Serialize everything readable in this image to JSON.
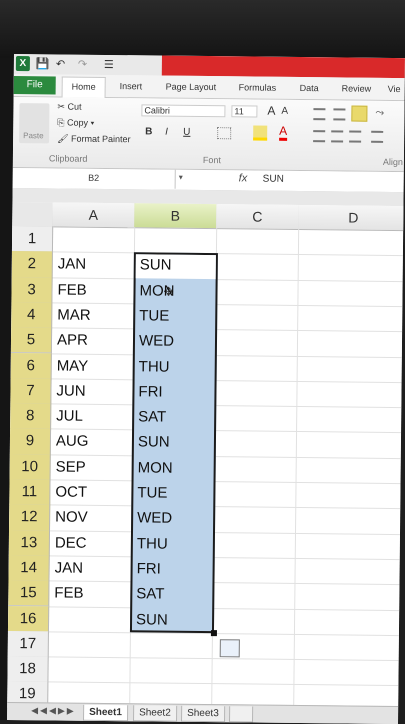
{
  "qat": {
    "app_icon": "X",
    "save": "💾",
    "undo": "↶",
    "redo": "↷",
    "customize": "☰"
  },
  "tabs": {
    "file": "File",
    "home": "Home",
    "insert": "Insert",
    "page_layout": "Page Layout",
    "formulas": "Formulas",
    "data": "Data",
    "review": "Review",
    "view": "Vie"
  },
  "ribbon": {
    "cut": "Cut",
    "copy": "Copy",
    "format_painter": "Format Painter",
    "paste": "Paste",
    "clipboard": "Clipboard",
    "font_name": "Calibri",
    "font_size": "11",
    "grow": "A",
    "shrink": "A",
    "bold": "B",
    "italic": "I",
    "underline": "U",
    "font_group": "Font",
    "alignment_group": "Align"
  },
  "formula_bar": {
    "name_box": "B2",
    "fx": "fx",
    "content": "SUN"
  },
  "columns": [
    "A",
    "B",
    "C",
    "D"
  ],
  "rows": [
    "1",
    "2",
    "3",
    "4",
    "5",
    "6",
    "7",
    "8",
    "9",
    "10",
    "11",
    "12",
    "13",
    "14",
    "15",
    "16",
    "17",
    "18",
    "19"
  ],
  "col_a": [
    "",
    "JAN",
    "FEB",
    "MAR",
    "APR",
    "MAY",
    "JUN",
    "JUL",
    "AUG",
    "SEP",
    "OCT",
    "NOV",
    "DEC",
    "JAN",
    "FEB",
    "",
    "",
    "",
    ""
  ],
  "col_b": [
    "",
    "SUN",
    "MON",
    "TUE",
    "WED",
    "THU",
    "FRI",
    "SAT",
    "SUN",
    "MON",
    "TUE",
    "WED",
    "THU",
    "FRI",
    "SAT",
    "SUN",
    "",
    "",
    ""
  ],
  "sheets": [
    "Sheet1",
    "Sheet2",
    "Sheet3"
  ]
}
